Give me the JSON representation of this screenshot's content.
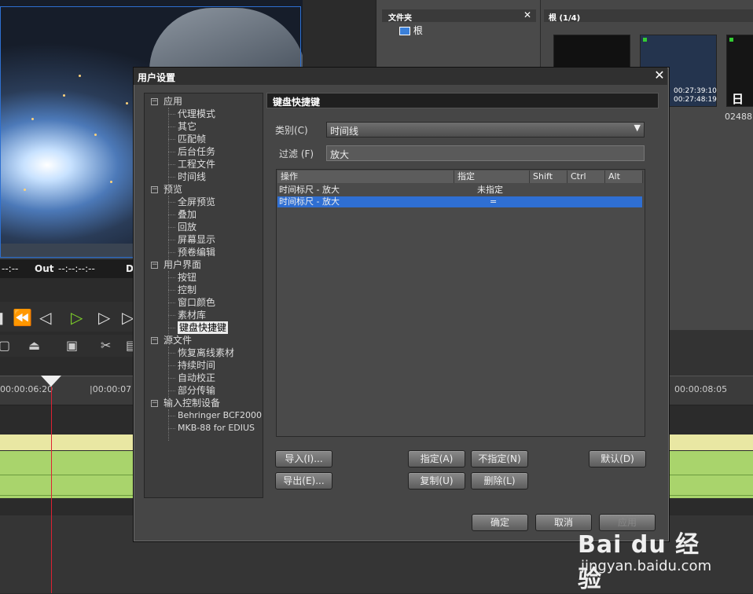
{
  "background": {
    "timecode_prefix": "--:--",
    "out_label": "Out",
    "out_value": "--:--:--:--",
    "d_label": "D",
    "ruler_ticks": [
      "00:00:06:20",
      "|00:00:07",
      "00:00:08:05"
    ],
    "folder_panel_title": "文件夹",
    "folder_root": "根",
    "bin_title": "根 (1/4)",
    "clip1_tc_in": "00:27:39:10",
    "clip1_tc_out": "00:27:48:19",
    "clip2_label": "日",
    "clip2_name": "02488"
  },
  "dialog": {
    "title": "用户设置",
    "close": "✕",
    "section_title": "键盘快捷键",
    "category_label": "类别(C)",
    "category_value": "时间线",
    "filter_label": "过滤 (F)",
    "filter_value": "放大",
    "tree": [
      {
        "label": "应用",
        "level": 0,
        "expander": "−"
      },
      {
        "label": "代理模式",
        "level": 1
      },
      {
        "label": "其它",
        "level": 1
      },
      {
        "label": "匹配帧",
        "level": 1
      },
      {
        "label": "后台任务",
        "level": 1
      },
      {
        "label": "工程文件",
        "level": 1
      },
      {
        "label": "时间线",
        "level": 1
      },
      {
        "label": "预览",
        "level": 0,
        "expander": "−"
      },
      {
        "label": "全屏预览",
        "level": 1
      },
      {
        "label": "叠加",
        "level": 1
      },
      {
        "label": "回放",
        "level": 1
      },
      {
        "label": "屏幕显示",
        "level": 1
      },
      {
        "label": "预卷编辑",
        "level": 1
      },
      {
        "label": "用户界面",
        "level": 0,
        "expander": "−"
      },
      {
        "label": "按钮",
        "level": 1
      },
      {
        "label": "控制",
        "level": 1
      },
      {
        "label": "窗口颜色",
        "level": 1
      },
      {
        "label": "素材库",
        "level": 1
      },
      {
        "label": "键盘快捷键",
        "level": 1,
        "selected": true
      },
      {
        "label": "源文件",
        "level": 0,
        "expander": "−"
      },
      {
        "label": "恢复离线素材",
        "level": 1
      },
      {
        "label": "持续时间",
        "level": 1
      },
      {
        "label": "自动校正",
        "level": 1
      },
      {
        "label": "部分传输",
        "level": 1
      },
      {
        "label": "输入控制设备",
        "level": 0,
        "expander": "−"
      },
      {
        "label": "Behringer BCF2000",
        "level": 1,
        "small": true
      },
      {
        "label": "MKB-88 for EDIUS",
        "level": 1,
        "small": true
      }
    ],
    "table": {
      "headers": [
        "操作",
        "指定",
        "Shift",
        "Ctrl",
        "Alt"
      ],
      "rows": [
        {
          "action": "时间标尺 - 放大",
          "assign": "未指定",
          "selected": false
        },
        {
          "action": "时间标尺 - 放大",
          "assign": "=",
          "selected": true
        }
      ]
    },
    "buttons": {
      "import": "导入(I)...",
      "export": "导出(E)...",
      "assign": "指定(A)",
      "unassign": "不指定(N)",
      "default": "默认(D)",
      "copy": "复制(U)",
      "delete": "删除(L)",
      "ok": "确定",
      "cancel": "取消",
      "apply": "应用"
    }
  },
  "watermark": {
    "brand": "Bai du 经验",
    "url": "jingyan.baidu.com"
  }
}
